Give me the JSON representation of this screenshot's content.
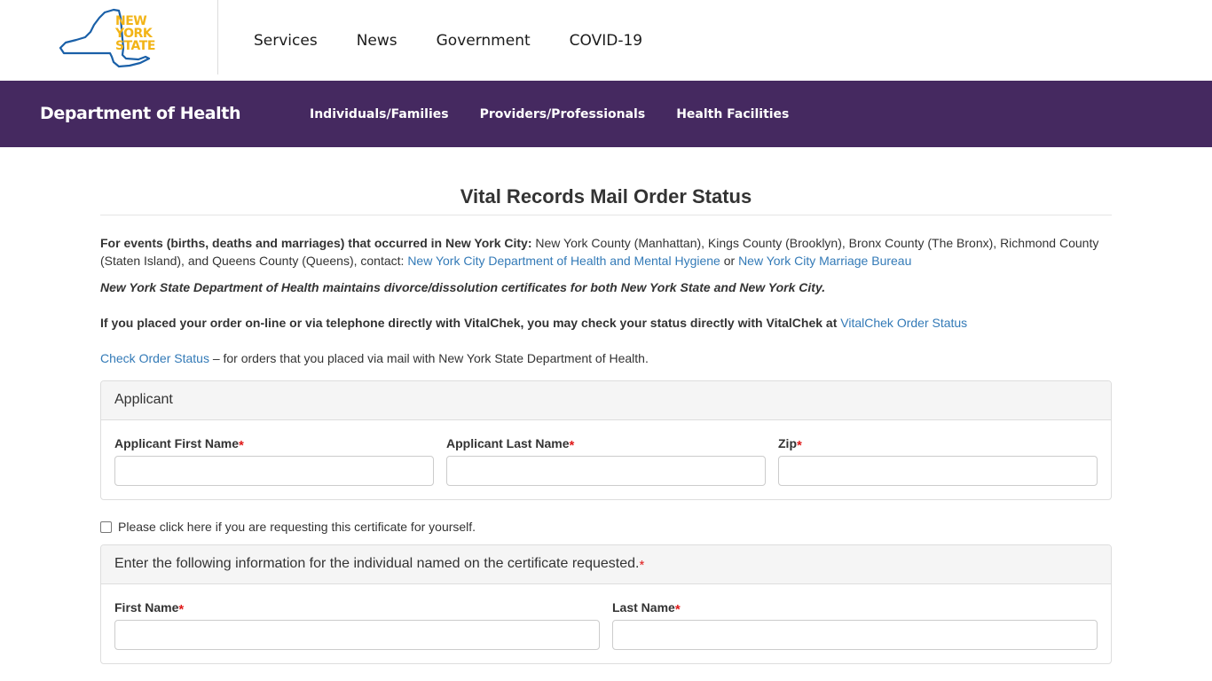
{
  "logo": {
    "line1": "NEW",
    "line2": "YORK",
    "line3": "STATE",
    "state_color": "#1a60a8",
    "text_color": "#f2b417"
  },
  "top_nav": {
    "items": [
      "Services",
      "News",
      "Government",
      "COVID-19"
    ]
  },
  "agency": {
    "title": "Department of Health",
    "nav": [
      "Individuals/Families",
      "Providers/Professionals",
      "Health Facilities"
    ],
    "bar_color": "#452960"
  },
  "page": {
    "title": "Vital Records Mail Order Status",
    "nyc_intro_bold": "For events (births, deaths and marriages) that occurred in New York City:",
    "nyc_intro_text": " New York County (Manhattan), Kings County (Brooklyn), Bronx County (The Bronx), Richmond County (Staten Island), and Queens County (Queens), contact: ",
    "nyc_link1": "New York City Department of Health and Mental Hygiene",
    "nyc_or": " or ",
    "nyc_link2": "New York City Marriage Bureau",
    "divorce_note": "New York State Department of Health maintains divorce/dissolution certificates for both New York State and New York City.",
    "vitalchek_bold": "If you placed your order on-line or via telephone directly with VitalChek, you may check your status directly with VitalChek at",
    "vitalchek_link": "VitalChek Order Status",
    "check_link": "Check Order Status",
    "check_text": " – for orders that you placed via mail with New York State Department of Health."
  },
  "applicant_panel": {
    "heading": "Applicant",
    "first_name_label": "Applicant First Name",
    "last_name_label": "Applicant Last Name",
    "zip_label": "Zip",
    "first_name_value": "",
    "last_name_value": "",
    "zip_value": ""
  },
  "self_checkbox": {
    "label": "Please click here if you are requesting this certificate for yourself.",
    "checked": false
  },
  "individual_panel": {
    "heading": "Enter the following information for the individual named on the certificate requested.",
    "first_name_label": "First Name",
    "last_name_label": "Last Name",
    "first_name_value": "",
    "last_name_value": ""
  },
  "required_marker": "*"
}
